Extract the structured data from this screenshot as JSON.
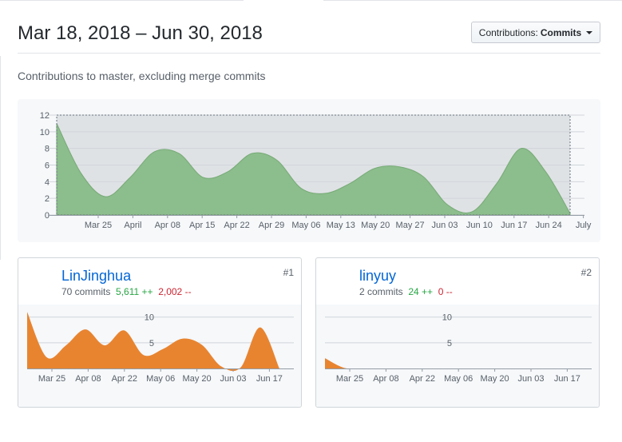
{
  "header": {
    "title": "Mar 18, 2018 – Jun 30, 2018",
    "contributions_label": "Contributions:",
    "contributions_value": "Commits",
    "subtitle": "Contributions to master, excluding merge commits"
  },
  "colors": {
    "main_area": "#8cbd8c",
    "main_area_stroke": "#76aa76",
    "contributor_area": "#e88430",
    "link": "#0366d6",
    "additions": "#28a745",
    "deletions": "#cb2431"
  },
  "chart_data": [
    {
      "type": "area",
      "x_ticks": [
        "Mar 25",
        "April",
        "Apr 08",
        "Apr 15",
        "Apr 22",
        "Apr 29",
        "May 06",
        "May 13",
        "May 20",
        "May 27",
        "Jun 03",
        "Jun 10",
        "Jun 17",
        "Jun 24",
        "July"
      ],
      "y_ticks": [
        "0",
        "2",
        "4",
        "6",
        "8",
        "10",
        "12"
      ],
      "ylim": [
        0,
        12
      ],
      "series": [
        {
          "values": [
            11,
            5,
            2.2,
            4.5,
            7.6,
            7.4,
            4.5,
            5.2,
            7.4,
            6.6,
            3.2,
            2.6,
            3.8,
            5.6,
            5.8,
            4.6,
            1.2,
            0.4,
            3.8,
            8,
            5.2,
            0.2
          ]
        }
      ]
    },
    {
      "type": "area",
      "x_ticks": [
        "Mar 25",
        "Apr 08",
        "Apr 22",
        "May 06",
        "May 20",
        "Jun 03",
        "Jun 17"
      ],
      "y_ticks": [
        "5",
        "10"
      ],
      "ylim": [
        0,
        14
      ],
      "series": [
        {
          "values": [
            11,
            2.2,
            4.5,
            7.6,
            4.5,
            7.4,
            2.6,
            3.8,
            5.8,
            4.6,
            0.4,
            0.2,
            8,
            0
          ]
        }
      ]
    },
    {
      "type": "area",
      "x_ticks": [
        "Mar 25",
        "Apr 08",
        "Apr 22",
        "May 06",
        "May 20",
        "Jun 03",
        "Jun 17"
      ],
      "y_ticks": [
        "5",
        "10"
      ],
      "ylim": [
        0,
        14
      ],
      "series": [
        {
          "values": [
            2,
            0.1,
            0,
            0,
            0,
            0,
            0,
            0,
            0,
            0,
            0,
            0,
            0,
            0
          ]
        }
      ]
    }
  ],
  "contributors": [
    {
      "name": "LinJinghua",
      "rank": "#1",
      "commits": "70 commits",
      "additions": "5,611 ++",
      "deletions": "2,002 --"
    },
    {
      "name": "linyuy",
      "rank": "#2",
      "commits": "2 commits",
      "additions": "24 ++",
      "deletions": "0 --"
    }
  ]
}
